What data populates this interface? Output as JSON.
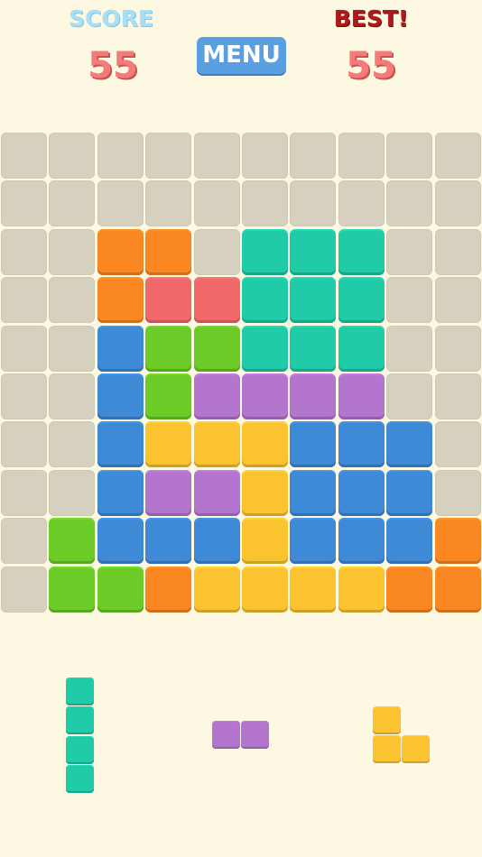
{
  "header": {
    "score_label": "SCORE",
    "score_value": "55",
    "best_label": "BEST!",
    "best_value": "55",
    "menu_label": "MENU"
  },
  "colors": {
    "E": "#d6d1bf",
    "O": "#fb8722",
    "R": "#f2696c",
    "T": "#20cca7",
    "B": "#3e8ad7",
    "G": "#6ccb26",
    "P": "#b475cf",
    "Y": "#fbc330"
  },
  "board": {
    "rows": 10,
    "cols": 10,
    "cells": [
      "EEEEEEEEEE",
      "EEEEEEEEEE",
      "EEOOETTTEE",
      "EEORRTTTEE",
      "EEBGGTTTEE",
      "EEBGPPPPEE",
      "EEBYYYBBBE",
      "EEBPPYBBBE",
      "EGBBBYBBBO",
      "EGGOYYYYOO"
    ]
  },
  "pieces": [
    {
      "name": "piece-vertical-i-teal",
      "color": "T",
      "shape": [
        "X",
        "X",
        "X",
        "X"
      ]
    },
    {
      "name": "piece-horizontal-domino-purple",
      "color": "P",
      "shape": [
        "XX"
      ]
    },
    {
      "name": "piece-l-corner-yellow",
      "color": "Y",
      "shape": [
        "X.",
        "XX"
      ]
    }
  ]
}
